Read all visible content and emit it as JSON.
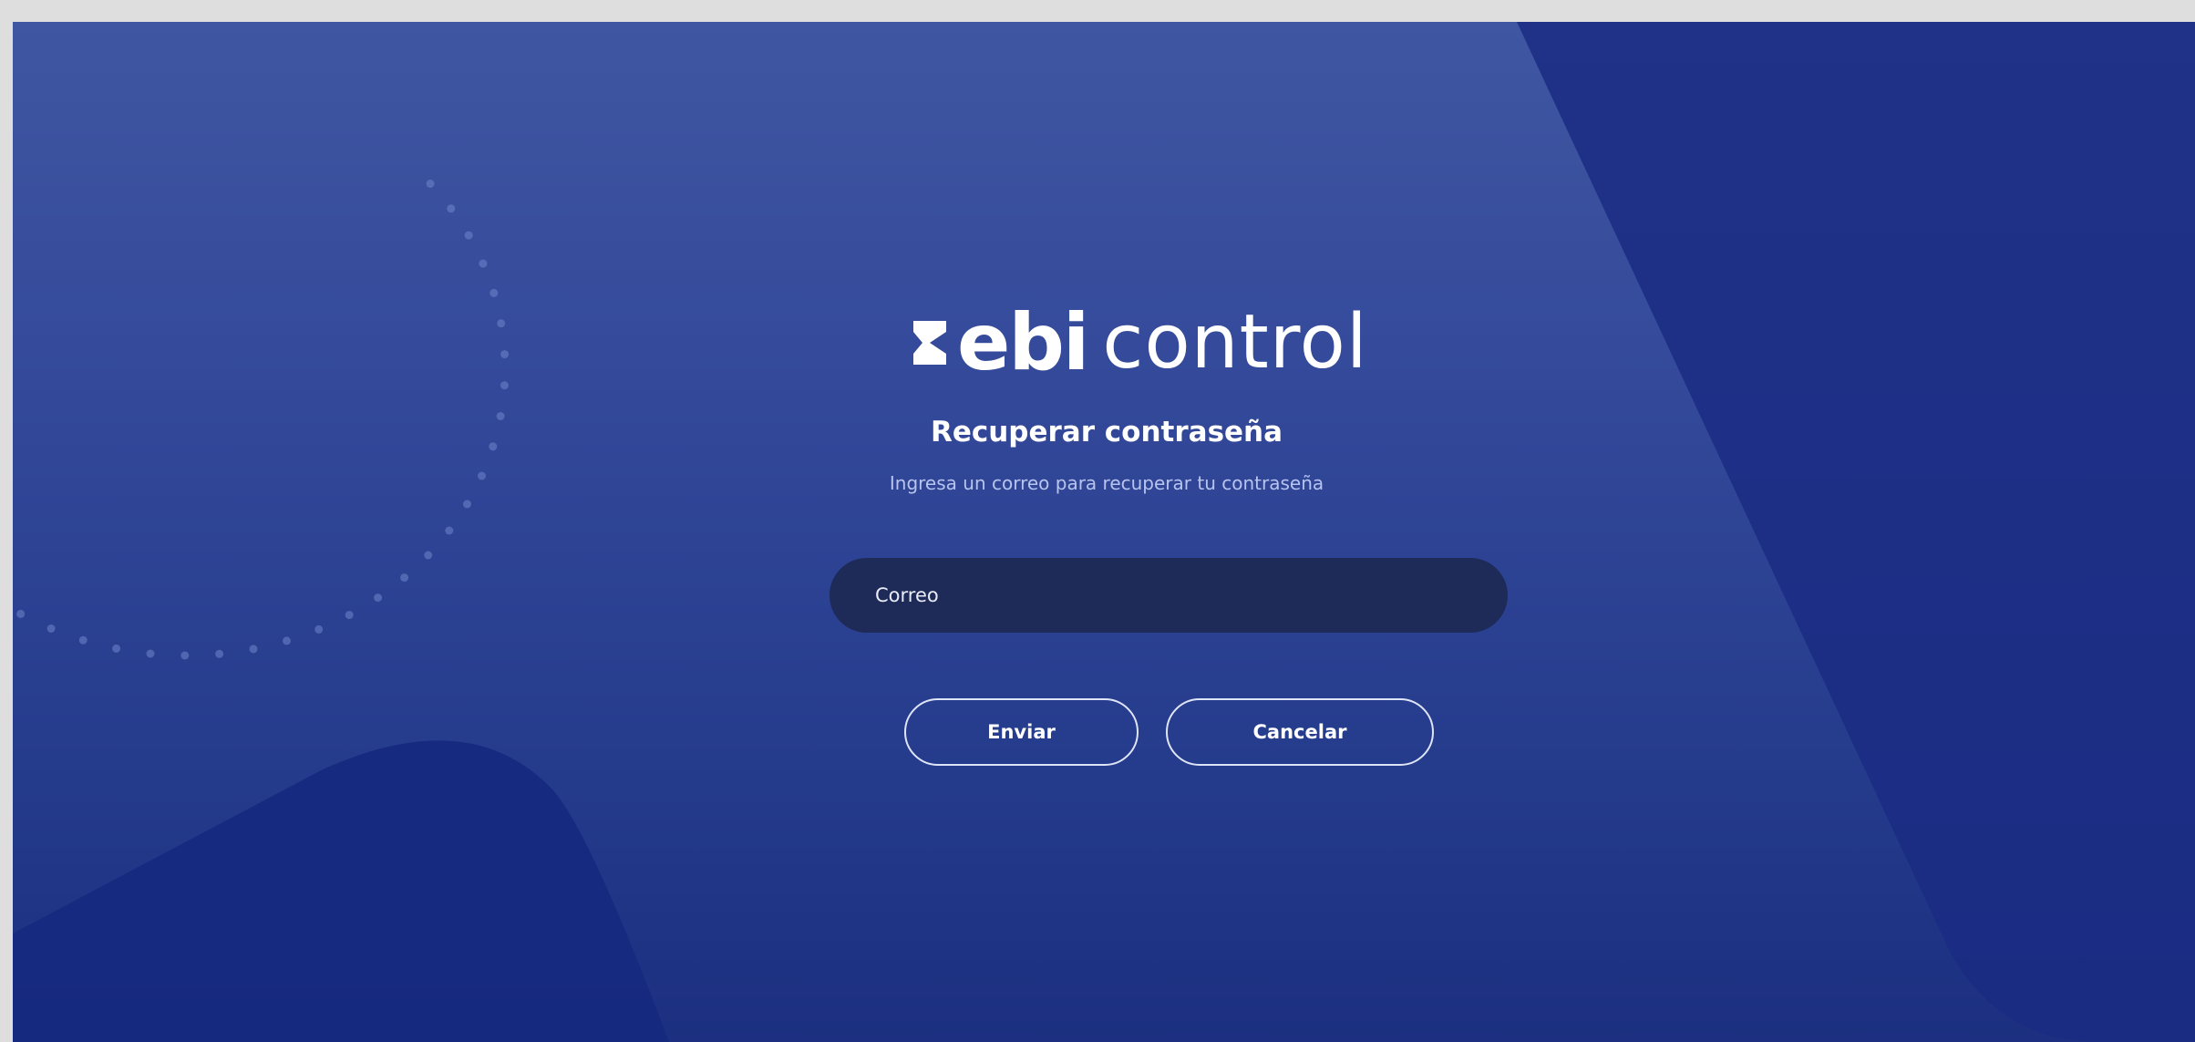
{
  "brand": {
    "logo_bold": "ebi",
    "logo_light": "control"
  },
  "page": {
    "title": "Recuperar contraseña",
    "subtitle": "Ingresa un correo para recuperar tu contraseña"
  },
  "form": {
    "email_placeholder": "Correo",
    "email_value": ""
  },
  "actions": {
    "send_label": "Enviar",
    "cancel_label": "Cancelar"
  },
  "colors": {
    "background_top": "#3f57a2",
    "background_bottom": "#1c2f80",
    "input_background": "#1e2a57",
    "text": "#ffffff",
    "subtitle_text": "#b7c4ee",
    "button_border": "#dfe5f8"
  }
}
